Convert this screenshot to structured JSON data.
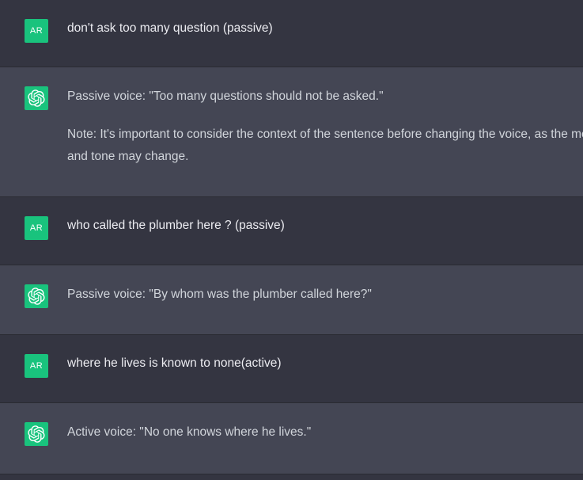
{
  "user_avatar_label": "AR",
  "colors": {
    "user_bg": "#343541",
    "assistant_bg": "#444654",
    "avatar_green": "#19c37d",
    "text": "#ececf1",
    "assistant_text": "#d1d5db"
  },
  "messages": [
    {
      "role": "user",
      "text": "don't ask too many question (passive)"
    },
    {
      "role": "assistant",
      "paragraphs": [
        "Passive voice: \"Too many questions should not be asked.\"",
        "Note: It's important to consider the context of the sentence before changing the voice, as the meaning and tone may change."
      ]
    },
    {
      "role": "user",
      "text": "who called the plumber here ? (passive)"
    },
    {
      "role": "assistant",
      "paragraphs": [
        "Passive voice: \"By whom was the plumber called here?\""
      ]
    },
    {
      "role": "user",
      "text": "where he lives is known to none(active)"
    },
    {
      "role": "assistant",
      "paragraphs": [
        "Active voice: \"No one knows where he lives.\""
      ]
    }
  ]
}
